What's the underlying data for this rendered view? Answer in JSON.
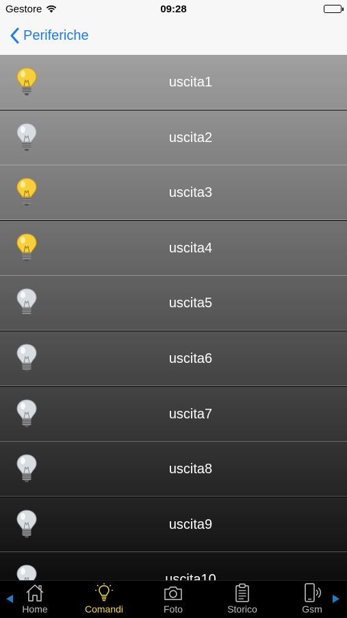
{
  "status_bar": {
    "carrier": "Gestore",
    "time": "09:28"
  },
  "nav": {
    "back_label": "Periferiche"
  },
  "outputs": [
    {
      "label": "uscita1",
      "state": "on"
    },
    {
      "label": "uscita2",
      "state": "off"
    },
    {
      "label": "uscita3",
      "state": "on"
    },
    {
      "label": "uscita4",
      "state": "on"
    },
    {
      "label": "uscita5",
      "state": "off"
    },
    {
      "label": "uscita6",
      "state": "off"
    },
    {
      "label": "uscita7",
      "state": "off"
    },
    {
      "label": "uscita8",
      "state": "off"
    },
    {
      "label": "uscita9",
      "state": "off"
    },
    {
      "label": "uscita10",
      "state": "off"
    }
  ],
  "tabs": [
    {
      "label": "Home",
      "icon": "home-icon"
    },
    {
      "label": "Comandi",
      "icon": "lightbulb-icon",
      "active": true
    },
    {
      "label": "Foto",
      "icon": "camera-icon"
    },
    {
      "label": "Storico",
      "icon": "clipboard-icon"
    },
    {
      "label": "Gsm",
      "icon": "phone-signal-icon"
    }
  ],
  "colors": {
    "accent": "#1a7bf2",
    "active_tab": "#f2dc2b",
    "bulb_on": "#f6cf3a",
    "bulb_off": "#d8dde2"
  }
}
